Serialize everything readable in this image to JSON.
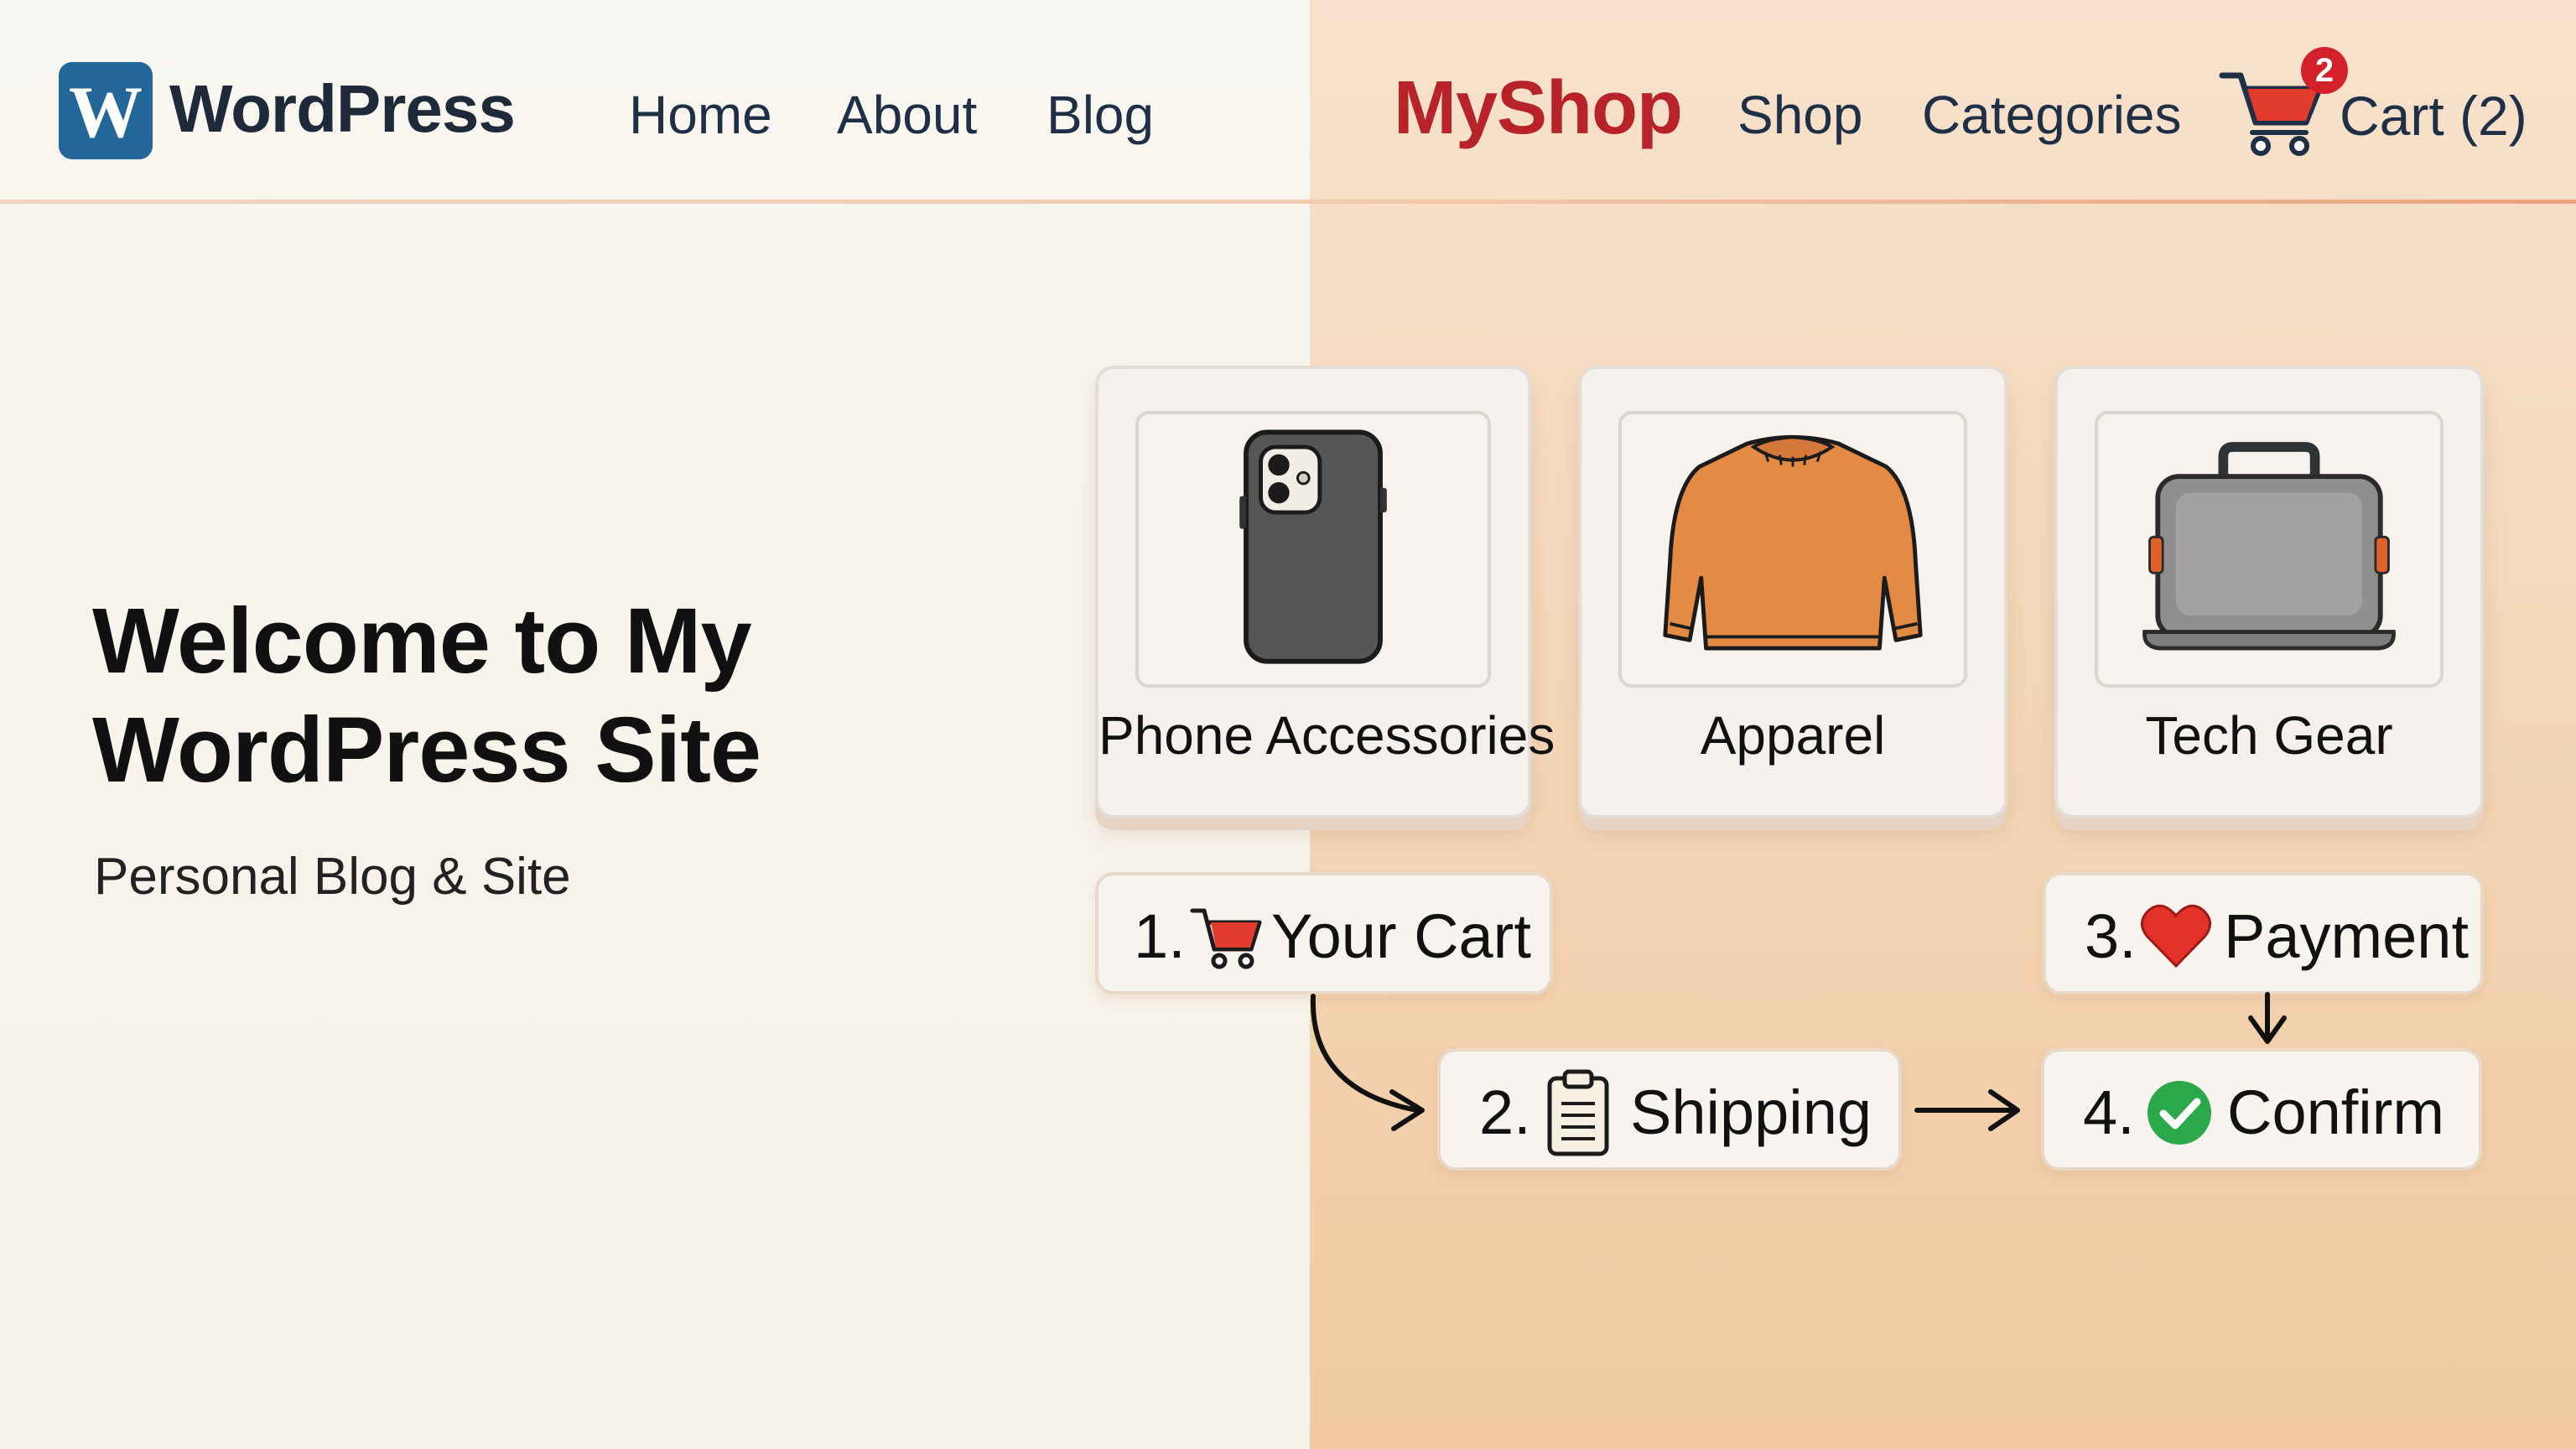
{
  "header": {
    "wp_brand": "WordPress",
    "wp_logo_letter": "W",
    "nav": [
      "Home",
      "About",
      "Blog"
    ],
    "shop_brand": "MyShop",
    "shop_nav": [
      "Shop",
      "Categories"
    ],
    "cart_label": "Cart (2)",
    "cart_badge": "2"
  },
  "hero": {
    "title": "Welcome to My WordPress Site",
    "subtitle": "Personal Blog & Site"
  },
  "categories": [
    {
      "label": "Phone Accessories",
      "icon": "phone-case-icon"
    },
    {
      "label": "Apparel",
      "icon": "sweater-icon"
    },
    {
      "label": "Tech Gear",
      "icon": "laptop-bag-icon"
    }
  ],
  "steps": [
    {
      "num": "1.",
      "label": "Your Cart",
      "icon": "shopping-cart-icon"
    },
    {
      "num": "2.",
      "label": "Shipping",
      "icon": "clipboard-icon"
    },
    {
      "num": "3.",
      "label": "Payment",
      "icon": "heart-icon"
    },
    {
      "num": "4.",
      "label": "Confirm",
      "icon": "check-circle-icon"
    }
  ],
  "colors": {
    "wp_blue": "#23669a",
    "shop_red": "#b8232a",
    "badge_red": "#d3212a",
    "apparel_orange": "#e38a45",
    "confirm_green": "#2aa84a"
  }
}
